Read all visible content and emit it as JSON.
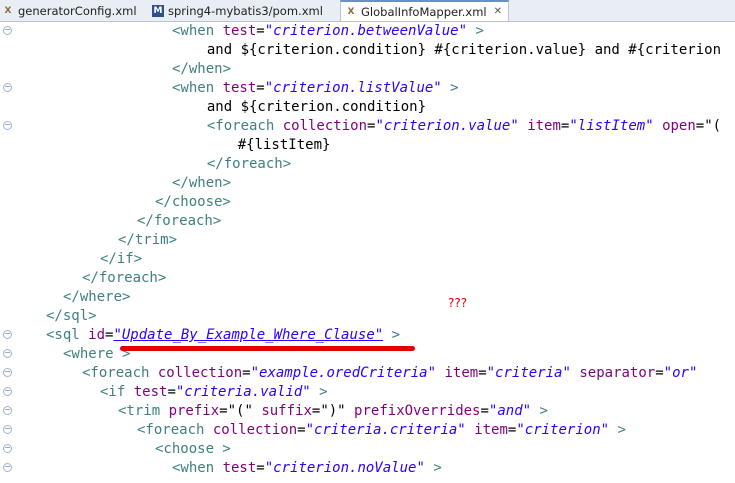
{
  "tabs": [
    {
      "label": "generatorConfig.xml",
      "icon": "xml-file-icon",
      "active": false
    },
    {
      "label": "spring4-mybatis3/pom.xml",
      "icon": "maven-icon",
      "active": false
    },
    {
      "label": "GlobalInfoMapper.xml",
      "icon": "xml-file-icon",
      "active": true
    }
  ],
  "annotation": "???",
  "lines": [
    {
      "fold": true,
      "parts": [
        [
          "t",
          "<when "
        ],
        [
          "a",
          "test"
        ],
        [
          "x",
          "="
        ],
        [
          "v",
          "\"criterion.betweenValue\""
        ],
        [
          "t",
          " >"
        ]
      ]
    },
    {
      "fold": false,
      "parts": [
        [
          "x",
          "  and ${criterion.condition} #{criterion.value} and #{criterion"
        ]
      ]
    },
    {
      "fold": false,
      "parts": [
        [
          "t",
          "</when>"
        ]
      ]
    },
    {
      "fold": true,
      "parts": [
        [
          "t",
          "<when "
        ],
        [
          "a",
          "test"
        ],
        [
          "x",
          "="
        ],
        [
          "v",
          "\"criterion.listValue\""
        ],
        [
          "t",
          " >"
        ]
      ]
    },
    {
      "fold": false,
      "parts": [
        [
          "x",
          "  and ${criterion.condition}"
        ]
      ]
    },
    {
      "fold": true,
      "parts": [
        [
          "t",
          "  <foreach "
        ],
        [
          "a",
          "collection"
        ],
        [
          "x",
          "="
        ],
        [
          "v",
          "\"criterion.value\""
        ],
        [
          "x",
          " "
        ],
        [
          "a",
          "item"
        ],
        [
          "x",
          "="
        ],
        [
          "v",
          "\"listItem\""
        ],
        [
          "x",
          " "
        ],
        [
          "a",
          "open"
        ],
        [
          "x",
          "=\"("
        ]
      ]
    },
    {
      "fold": false,
      "parts": [
        [
          "x",
          "    #{listItem}"
        ]
      ]
    },
    {
      "fold": false,
      "parts": [
        [
          "t",
          "  </foreach>"
        ]
      ]
    },
    {
      "fold": false,
      "parts": [
        [
          "t",
          "</when>"
        ]
      ]
    },
    {
      "fold": false,
      "parts": [
        [
          "t",
          "</choose>"
        ]
      ]
    },
    {
      "fold": false,
      "parts": [
        [
          "t",
          "</foreach>"
        ]
      ]
    },
    {
      "fold": false,
      "parts": [
        [
          "t",
          "</trim>"
        ]
      ]
    },
    {
      "fold": false,
      "parts": [
        [
          "t",
          "</if>"
        ]
      ]
    },
    {
      "fold": false,
      "parts": [
        [
          "t",
          "</foreach>"
        ]
      ]
    },
    {
      "fold": false,
      "parts": [
        [
          "t",
          "</where>"
        ]
      ]
    },
    {
      "fold": false,
      "parts": [
        [
          "t",
          "</sql>"
        ]
      ]
    },
    {
      "fold": true,
      "parts": [
        [
          "t",
          "<sql "
        ],
        [
          "a",
          "id"
        ],
        [
          "x",
          "="
        ],
        [
          "vu",
          "\"Update_By_Example_Where_Clause\""
        ],
        [
          "t",
          " >"
        ]
      ]
    },
    {
      "fold": true,
      "parts": [
        [
          "t",
          "<where >"
        ]
      ]
    },
    {
      "fold": true,
      "parts": [
        [
          "t",
          "<foreach "
        ],
        [
          "a",
          "collection"
        ],
        [
          "x",
          "="
        ],
        [
          "v",
          "\"example.oredCriteria\""
        ],
        [
          "x",
          " "
        ],
        [
          "a",
          "item"
        ],
        [
          "x",
          "="
        ],
        [
          "v",
          "\"criteria\""
        ],
        [
          "x",
          " "
        ],
        [
          "a",
          "separator"
        ],
        [
          "x",
          "="
        ],
        [
          "v",
          "\"or\""
        ]
      ]
    },
    {
      "fold": true,
      "parts": [
        [
          "t",
          "<if "
        ],
        [
          "a",
          "test"
        ],
        [
          "x",
          "="
        ],
        [
          "v",
          "\"criteria.valid\""
        ],
        [
          "t",
          " >"
        ]
      ]
    },
    {
      "fold": true,
      "parts": [
        [
          "t",
          "<trim "
        ],
        [
          "a",
          "prefix"
        ],
        [
          "x",
          "=\"(\" "
        ],
        [
          "a",
          "suffix"
        ],
        [
          "x",
          "=\")\" "
        ],
        [
          "a",
          "prefixOverrides"
        ],
        [
          "x",
          "="
        ],
        [
          "v",
          "\"and\""
        ],
        [
          "t",
          " >"
        ]
      ]
    },
    {
      "fold": true,
      "parts": [
        [
          "t",
          "<foreach "
        ],
        [
          "a",
          "collection"
        ],
        [
          "x",
          "="
        ],
        [
          "v",
          "\"criteria.criteria\""
        ],
        [
          "x",
          " "
        ],
        [
          "a",
          "item"
        ],
        [
          "x",
          "="
        ],
        [
          "v",
          "\"criterion\""
        ],
        [
          "t",
          " >"
        ]
      ]
    },
    {
      "fold": true,
      "parts": [
        [
          "t",
          "<choose >"
        ]
      ]
    },
    {
      "fold": true,
      "parts": [
        [
          "t",
          "<when "
        ],
        [
          "a",
          "test"
        ],
        [
          "x",
          "="
        ],
        [
          "v",
          "\"criterion.noValue\""
        ],
        [
          "t",
          " >"
        ]
      ]
    }
  ]
}
